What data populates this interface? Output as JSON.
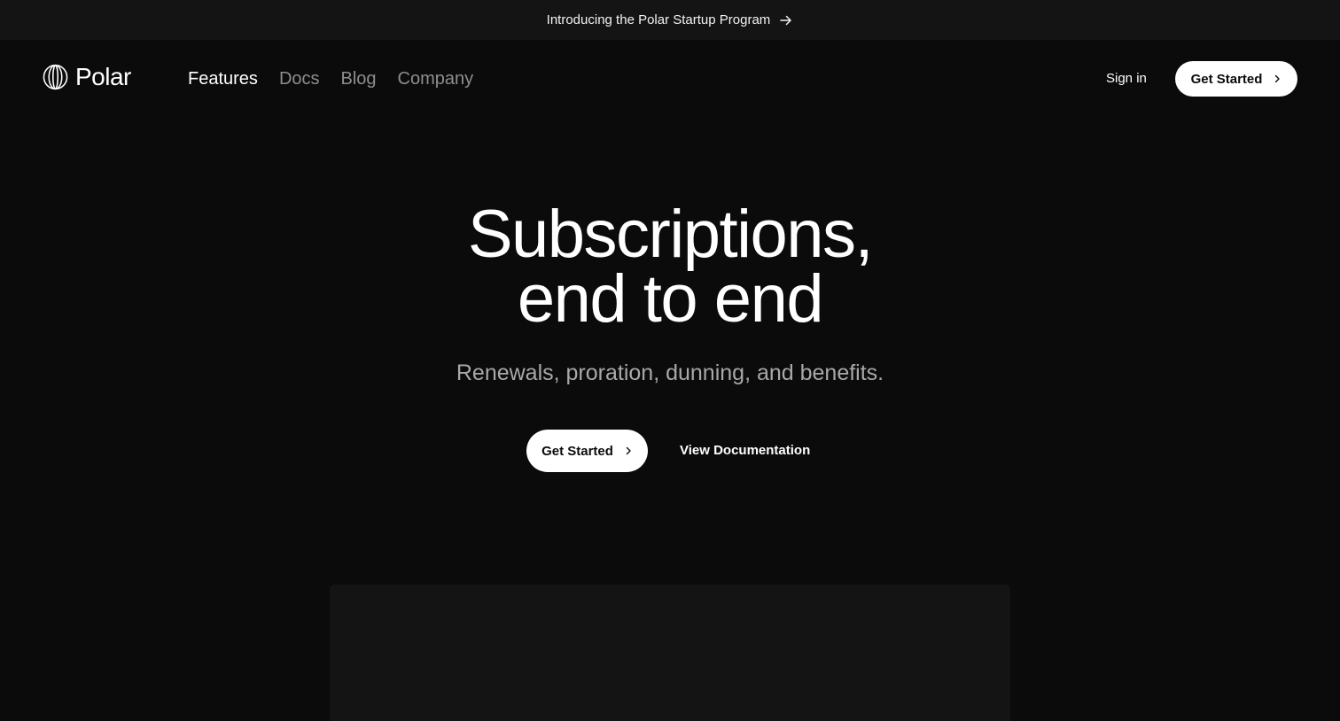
{
  "announcement": {
    "text": "Introducing the Polar Startup Program",
    "icon": "arrow-right-icon"
  },
  "header": {
    "logo_text": "Polar",
    "logo_icon": "polar-logo-icon",
    "nav": [
      {
        "label": "Features",
        "active": true
      },
      {
        "label": "Docs",
        "active": false
      },
      {
        "label": "Blog",
        "active": false
      },
      {
        "label": "Company",
        "active": false
      }
    ],
    "sign_in": "Sign in",
    "get_started": "Get Started"
  },
  "hero": {
    "title_line1": "Subscriptions,",
    "title_line2": "end to end",
    "subtitle": "Renewals, proration, dunning, and benefits.",
    "primary_cta": "Get Started",
    "secondary_cta": "View Documentation"
  },
  "colors": {
    "background": "#0b0b0b",
    "announcement_bar": "#141414",
    "muted_text": "#8e8e8e",
    "subtitle_text": "#a8a8a8",
    "button_bg": "#ffffff",
    "button_text": "#0b0b0b",
    "panel": "#141414"
  }
}
